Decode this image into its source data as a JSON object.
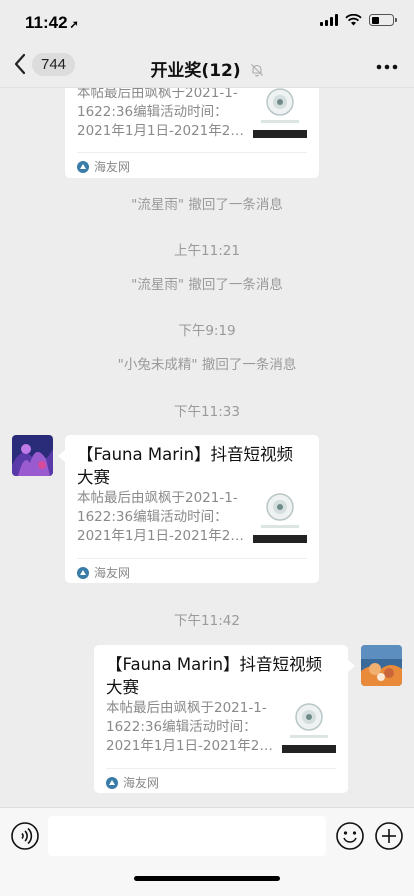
{
  "status": {
    "time": "11:42",
    "location_arrow": "➚"
  },
  "nav": {
    "back_count": "744",
    "title": "开业奖(12)"
  },
  "messages": {
    "card_top": {
      "desc": [
        "本帖最后由飒枫于2021-1-",
        "1622:36编辑活动时间：",
        "2021年1月1日-2021年2…"
      ],
      "source": "海友网"
    },
    "recall_1": "\"流星雨\" 撤回了一条消息",
    "time_1": "上午11:21",
    "recall_2": "\"流星雨\" 撤回了一条消息",
    "time_2": "下午9:19",
    "recall_3": "\"小兔未成精\" 撤回了一条消息",
    "time_3": "下午11:33",
    "card_left": {
      "title": "【Fauna Marin】抖音短视频大赛",
      "desc": [
        "本帖最后由飒枫于2021-1-",
        "1622:36编辑活动时间：",
        "2021年1月1日-2021年2…"
      ],
      "source": "海友网"
    },
    "time_4": "下午11:42",
    "card_right": {
      "title": "【Fauna Marin】抖音短视频大赛",
      "desc": [
        "本帖最后由飒枫于2021-1-",
        "1622:36编辑活动时间：",
        "2021年1月1日-2021年2…"
      ],
      "source": "海友网"
    }
  },
  "icons": {
    "back": "chevron-left-icon",
    "mute": "bell-off-icon",
    "more": "more-dots-icon",
    "voice": "voice-icon",
    "emoji": "emoji-icon",
    "add": "plus-circle-icon"
  },
  "colors": {
    "background": "#ededed",
    "card": "#ffffff",
    "system_text": "#9a9a9a"
  }
}
